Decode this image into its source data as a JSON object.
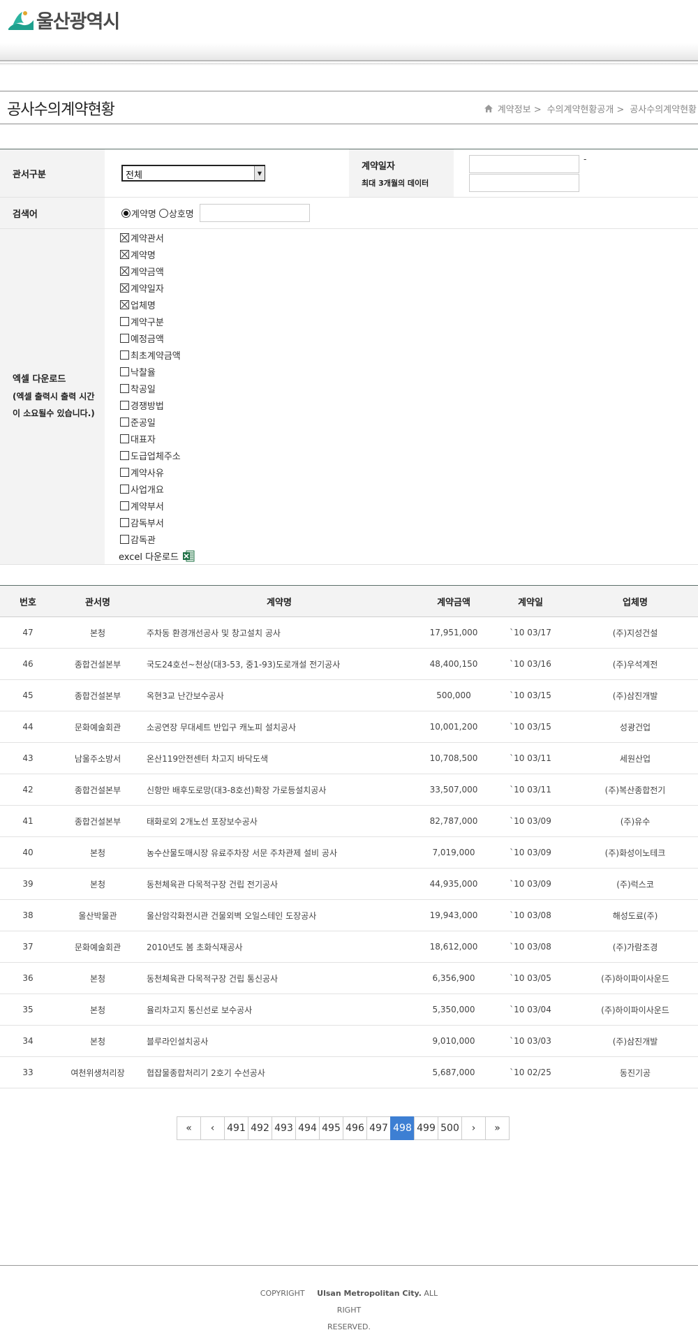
{
  "header": {
    "logo_text": "울산광역시"
  },
  "page": {
    "title": "공사수의계약현황",
    "breadcrumb": [
      "계약정보 >",
      "수의계약현황공개 >",
      "공사수의계약현황"
    ]
  },
  "form": {
    "dept_label": "관서구분",
    "dept_value": "전체",
    "date_label": "계약일자",
    "date_sub": "최대 3개월의 데이터",
    "date_dash": "-",
    "keyword_label": "검색어",
    "radio_contract": "계약명",
    "radio_company": "상호명",
    "excel_label": "엑셀 다운로드",
    "excel_note_1": "(엑셀 출력시 출력 시간",
    "excel_note_2": "이 소요될수 있습니다.)",
    "checkboxes": [
      {
        "label": "계약관서",
        "checked": true
      },
      {
        "label": "계약명",
        "checked": true
      },
      {
        "label": "계약금액",
        "checked": true
      },
      {
        "label": "계약일자",
        "checked": true
      },
      {
        "label": "업체명",
        "checked": true
      },
      {
        "label": "계약구분",
        "checked": false
      },
      {
        "label": "예정금액",
        "checked": false
      },
      {
        "label": "최초계약금액",
        "checked": false
      },
      {
        "label": "낙찰율",
        "checked": false
      },
      {
        "label": "착공일",
        "checked": false
      },
      {
        "label": "경쟁방법",
        "checked": false
      },
      {
        "label": "준공일",
        "checked": false
      },
      {
        "label": "대표자",
        "checked": false
      },
      {
        "label": "도급업체주소",
        "checked": false
      },
      {
        "label": "계약사유",
        "checked": false
      },
      {
        "label": "사업개요",
        "checked": false
      },
      {
        "label": "계약부서",
        "checked": false
      },
      {
        "label": "감독부서",
        "checked": false
      },
      {
        "label": "감독관",
        "checked": false
      }
    ],
    "excel_download": "excel 다운로드"
  },
  "table": {
    "headers": [
      "번호",
      "관서명",
      "계약명",
      "계약금액",
      "계약일",
      "업체명"
    ],
    "rows": [
      [
        "47",
        "본청",
        "주차동 환경개선공사 및 창고설치 공사",
        "17,951,000",
        "`10 03/17",
        "(주)지성건설"
      ],
      [
        "46",
        "종합건설본부",
        "국도24호선~천상(대3-53, 중1-93)도로개설 전기공사",
        "48,400,150",
        "`10 03/16",
        "(주)우석계전"
      ],
      [
        "45",
        "종합건설본부",
        "옥현3교 난간보수공사",
        "500,000",
        "`10 03/15",
        "(주)삼진개발"
      ],
      [
        "44",
        "문화예술회관",
        "소공연장 무대세트 반입구 캐노피 설치공사",
        "10,001,200",
        "`10 03/15",
        "성광건업"
      ],
      [
        "43",
        "남울주소방서",
        "온산119안전센터 차고지 바닥도색",
        "10,708,500",
        "`10 03/11",
        "세원산업"
      ],
      [
        "42",
        "종합건설본부",
        "신항만 배후도로망(대3-8호선)확장 가로등설치공사",
        "33,507,000",
        "`10 03/11",
        "(주)복산종합전기"
      ],
      [
        "41",
        "종합건설본부",
        "태화로외 2개노선 포장보수공사",
        "82,787,000",
        "`10 03/09",
        "(주)유수"
      ],
      [
        "40",
        "본청",
        "농수산물도매시장 유료주차장 서문 주차관제 설비 공사",
        "7,019,000",
        "`10 03/09",
        "(주)화성이노테크"
      ],
      [
        "39",
        "본청",
        "동천체육관 다목적구장 건립 전기공사",
        "44,935,000",
        "`10 03/09",
        "(주)럭스코"
      ],
      [
        "38",
        "울산박물관",
        "울산암각화전시관 건물외벽 오일스테인 도장공사",
        "19,943,000",
        "`10 03/08",
        "해성도료(주)"
      ],
      [
        "37",
        "문화예술회관",
        "2010년도 봄 초화식재공사",
        "18,612,000",
        "`10 03/08",
        "(주)가람조경"
      ],
      [
        "36",
        "본청",
        "동천체육관 다목적구장 건립 통신공사",
        "6,356,900",
        "`10 03/05",
        "(주)하이파이사운드"
      ],
      [
        "35",
        "본청",
        "율리차고지 통신선로 보수공사",
        "5,350,000",
        "`10 03/04",
        "(주)하이파이사운드"
      ],
      [
        "34",
        "본청",
        "블루라인설치공사",
        "9,010,000",
        "`10 03/03",
        "(주)삼진개발"
      ],
      [
        "33",
        "여천위생처리장",
        "협잡물종합처리기 2호기 수선공사",
        "5,687,000",
        "`10 02/25",
        "동진기공"
      ]
    ]
  },
  "pagination": {
    "first": "«",
    "prev": "‹",
    "pages": [
      "491",
      "492",
      "493",
      "494",
      "495",
      "496",
      "497",
      "498",
      "499",
      "500"
    ],
    "current": "498",
    "next": "›",
    "last": "»"
  },
  "footer": {
    "copyright_prefix": "COPYRIGHT",
    "copyright_org": "Ulsan Metropolitan City.",
    "copyright_suffix": "ALL RIGHT",
    "copyright_line2": "RESERVED."
  },
  "colors": {
    "accent": "#3d7fd3",
    "logo_teal": "#1fa08e",
    "excel_green": "#1e7145"
  },
  "icons": {
    "home": "home-icon",
    "excel": "excel-icon",
    "logo": "ulsan-logo-icon",
    "select_arrow": "chevron-down-icon"
  }
}
